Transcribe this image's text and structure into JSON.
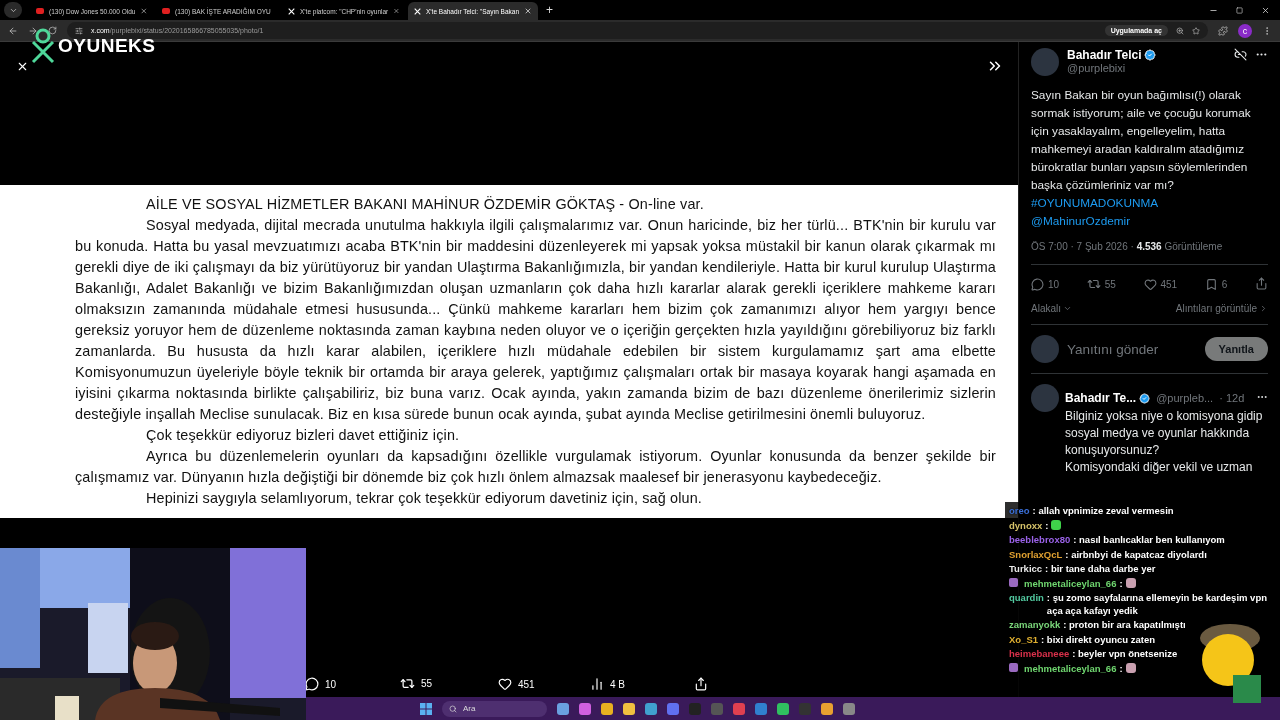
{
  "browser": {
    "tabs": [
      {
        "title": "(130) Dow Jones 50.000 Oldu",
        "kind": "video",
        "selected": false
      },
      {
        "title": "(130) BAK İŞTE ARADIĞIM OYU",
        "kind": "video",
        "selected": false
      },
      {
        "title": "X'te platcom: \"CHP'nin oyunlar",
        "kind": "x",
        "selected": false
      },
      {
        "title": "X'te Bahadır Telci: \"Sayın Bakan",
        "kind": "x",
        "selected": true
      }
    ],
    "new_tab": "+",
    "url_host": "x.com",
    "url_path": "/purplebixi/status/2020165866785055035/photo/1",
    "open_in_app": "Uygulamada aç",
    "profile": "c"
  },
  "overlay_logo": "OYUNEKS",
  "document": {
    "paragraphs": [
      {
        "kind": "heading",
        "text": "AİLE VE SOSYAL HİZMETLER BAKANI MAHİNUR ÖZDEMİR GÖKTAŞ - On-line var."
      },
      {
        "kind": "body",
        "text": "Sosyal medyada, dijital mecrada unutulma hakkıyla ilgili çalışmalarımız var. Onun haricinde, biz her türlü... BTK'nin bir kurulu var bu konuda. Hatta bu yasal mevzuatımızı acaba BTK'nin bir maddesini düzenleyerek mi yapsak yoksa müstakil bir kanun olarak çıkarmak mı gerekli diye de iki çalışmayı da biz yürütüyoruz bir yandan Ulaştırma Bakanlığımızla, bir yandan kendileriyle. Hatta bir kurul kurulup Ulaştırma Bakanlığı, Adalet Bakanlığı ve bizim Bakanlığımızdan oluşan uzmanların çok daha hızlı kararlar alarak gerekli içeriklere mahkeme kararı olmaksızın zamanında müdahale etmesi hususunda... Çünkü mahkeme kararları hem bizim çok zamanımızı alıyor hem yargıyı bence gereksiz yoruyor hem de düzenleme noktasında zaman kaybına neden oluyor ve o içeriğin gerçekten hızla yayıldığını görebiliyoruz biz farklı zamanlarda. Bu hususta da hızlı karar alabilen, içeriklere hızlı müdahale edebilen bir sistem kurgulamamız şart ama elbette Komisyonumuzun üyeleriyle böyle teknik bir ortamda bir araya gelerek, yaptığımız çalışmaları ortak bir masaya koyarak hangi aşamada en iyisini çıkarma noktasında birlikte çalışabiliriz, biz buna varız. Ocak ayında, yakın zamanda bizim de bazı düzenleme önerilerimiz sizlerin desteğiyle inşallah Meclise sunulacak. Biz en kısa sürede bunun ocak ayında, şubat ayında Meclise getirilmesini önemli buluyoruz."
      },
      {
        "kind": "body",
        "text": "Çok teşekkür ediyoruz bizleri davet ettiğiniz için."
      },
      {
        "kind": "body",
        "text": "Ayrıca bu düzenlemelerin oyunları da kapsadığını özellikle vurgulamak istiyorum. Oyunlar konusunda da benzer şekilde bir çalışmamız var. Dünyanın hızla değiştiği bir dönemde biz çok hızlı önlem almazsak maalesef bir jenerasyonu kaybedeceğiz."
      },
      {
        "kind": "body",
        "text": "Hepinizi saygıyla selamlıyorum, tekrar çok teşekkür ediyorum davetiniz için, sağ olun."
      }
    ]
  },
  "photo_stats": {
    "replies": "10",
    "reposts": "55",
    "likes": "451",
    "views": "4 B"
  },
  "tweet": {
    "name": "Bahadır Telci",
    "handle": "@purplebixi",
    "verified": true,
    "text": "Sayın Bakan bir oyun bağımlısı(!) olarak sormak istiyorum; aile ve çocuğu korumak için yasaklayalım, engelleyelim, hatta mahkemeyi aradan kaldıralım atadığımız bürokratlar bunları yapsın söylemlerinden başka çözümleriniz var mı?",
    "hashtag": "#OYUNUMADOKUNMA",
    "mention": "@MahinurOzdemir",
    "meta": "ÖS 7:00 · 7 Şub 2026 · **4.536** Görüntüleme",
    "replies": "10",
    "reposts": "55",
    "likes": "451",
    "bookmarks": "6",
    "sort": "Alakalı",
    "quotes_link": "Alıntıları görüntüle"
  },
  "reply_box": {
    "placeholder": "Yanıtını gönder",
    "button": "Yanıtla",
    "disabled": true
  },
  "reply": {
    "name": "Bahadır Te...",
    "handle": "@purpleb...",
    "time": "· 12d",
    "verified": true,
    "lines": [
      "Bilginiz yoksa niye o komisyona gidip sosyal medya ve oyunlar hakkında konuşuyorsunuz?",
      "Komisyondaki diğer vekil ve uzman"
    ]
  },
  "chat": [
    {
      "user": "oreo",
      "color": "#3a6fd8",
      "text": ": allah vpnimize zeval vermesin"
    },
    {
      "user": "dynoxx",
      "color": "#d6c36a",
      "text": ":",
      "emote": true
    },
    {
      "user": "beeblebrox80",
      "color": "#9a62e8",
      "text": ": nasıl banlıcaklar ben kullanıyom"
    },
    {
      "user": "SnorlaxQcL",
      "color": "#e0a030",
      "text": ": airbnbyi de kapatcaz diyolardı"
    },
    {
      "user": "Turkicc",
      "color": "#e8e8e8",
      "text": ": bir tane daha darbe yer"
    },
    {
      "user": "mehmetaliceylan_66",
      "color": "#6fd66f",
      "text": ":",
      "badge": true,
      "emote": true
    },
    {
      "user": "quardin",
      "color": "#52c9a0",
      "text": ": şu zomo sayfalarına ellemeyin be kardeşim vpn aça aça kafayı yedik"
    },
    {
      "user": "zamanyokk",
      "color": "#7ad67a",
      "text": ": proton bir ara kapatılmıştı"
    },
    {
      "user": "Xo_S1",
      "color": "#e0b030",
      "text": ": bixi direkt oyuncu zaten"
    },
    {
      "user": "heimebaneee",
      "color": "#d8304a",
      "text": ": beyler vpn önetsenize"
    },
    {
      "user": "mehmetaliceylan_66",
      "color": "#6fd66f",
      "text": ":",
      "badge": true,
      "emote": true
    }
  ],
  "taskbar": {
    "search": "Ara"
  }
}
